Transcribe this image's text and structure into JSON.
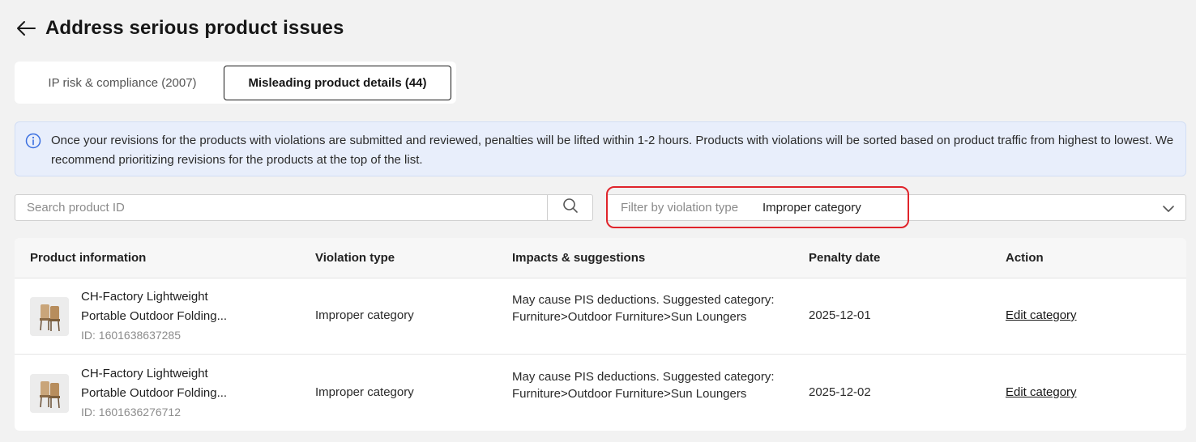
{
  "header": {
    "title": "Address serious product issues",
    "back_icon": "arrow-left-icon"
  },
  "tabs": [
    {
      "label": "IP risk & compliance (2007)",
      "active": false
    },
    {
      "label": "Misleading product details (44)",
      "active": true
    }
  ],
  "notice": {
    "icon": "info-icon",
    "text": "Once your revisions for the products with violations are submitted and reviewed, penalties will be lifted within 1-2 hours. Products with violations will be sorted based on product traffic from highest to lowest. We recommend prioritizing revisions for the products at the top of the list."
  },
  "search": {
    "placeholder": "Search product ID",
    "value": "",
    "icon": "search-icon"
  },
  "filter": {
    "label": "Filter by violation type",
    "value": "Improper category",
    "icon": "chevron-down-icon"
  },
  "colors": {
    "highlight": "#e0242b",
    "notice_bg": "#e8eefb",
    "info_icon": "#3a6fe0"
  },
  "table": {
    "headers": [
      "Product information",
      "Violation type",
      "Impacts & suggestions",
      "Penalty date",
      "Action"
    ],
    "rows": [
      {
        "name_line1": "CH-Factory Lightweight",
        "name_line2": "Portable Outdoor Folding...",
        "id": "ID: 1601638637285",
        "violation": "Improper category",
        "impact": "May cause PIS deductions. Suggested category: Furniture>Outdoor Furniture>Sun Loungers",
        "date": "2025-12-01",
        "action": "Edit category"
      },
      {
        "name_line1": "CH-Factory Lightweight",
        "name_line2": "Portable Outdoor Folding...",
        "id": "ID: 1601636276712",
        "violation": "Improper category",
        "impact": "May cause PIS deductions. Suggested category: Furniture>Outdoor Furniture>Sun Loungers",
        "date": "2025-12-02",
        "action": "Edit category"
      }
    ]
  }
}
